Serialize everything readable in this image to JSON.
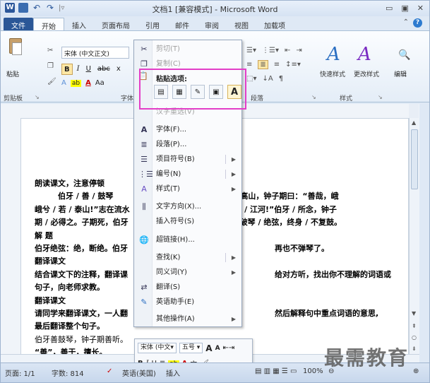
{
  "window": {
    "title": "文档1 [兼容模式] - Microsoft Word",
    "controls": [
      "▭",
      "▣",
      "✕"
    ]
  },
  "qat": {
    "separator": "|▿"
  },
  "tabs": [
    {
      "label": "文件"
    },
    {
      "label": "开始"
    },
    {
      "label": "插入"
    },
    {
      "label": "页面布局"
    },
    {
      "label": "引用"
    },
    {
      "label": "邮件"
    },
    {
      "label": "审阅"
    },
    {
      "label": "视图"
    },
    {
      "label": "加载项"
    }
  ],
  "ribbon": {
    "paste_label": "粘贴",
    "clipboard_group": "剪贴板",
    "font_group": "字体",
    "paragraph_group": "段落",
    "styles_group": "样式",
    "font_name": "宋体 (中文正文)",
    "quick_styles": "快速样式",
    "change_styles": "更改样式",
    "edit": "编辑",
    "bold": "B",
    "italic": "I",
    "underline": "U",
    "strike": "abc",
    "superscript": "x",
    "font_color": "A",
    "highlight": "ab",
    "font_preview": "Aa",
    "ribbon_collapse": "⌃"
  },
  "context_menu": {
    "cut": "剪切(T)",
    "copy": "复制(C)",
    "paste_options": "粘贴选项:",
    "paste_opt_text": "A",
    "text_reconvert": "汉字重选(V)",
    "font": "字体(F)...",
    "paragraph": "段落(P)...",
    "bullets": "项目符号(B)",
    "numbering": "编号(N)",
    "styles": "样式(T)",
    "text_direction": "文字方向(X)...",
    "insert_symbol": "插入符号(S)",
    "hyperlink": "超链接(H)...",
    "lookup": "查找(K)",
    "synonyms": "同义词(Y)",
    "translate": "翻译(S)",
    "english_assistant": "英语助手(E)",
    "other_actions": "其他操作(A)"
  },
  "mini_toolbar": {
    "font": "宋体 (中文▾",
    "size": "五号 ▾",
    "grow": "A",
    "shrink": "A",
    "bold": "B",
    "italic": "I",
    "underline": "U"
  },
  "document": {
    "lines": [
      {
        "text": "朗读课文，注意停顿",
        "bold": true
      },
      {
        "text": "　　　伯牙 / 善 / 鼓琴",
        "bold": true,
        "tail": "志在高山，钟子期曰：“善哉，峨"
      },
      {
        "text": "峨兮 / 若 / 泰山!”志在流水",
        "bold": true,
        "tail": "兮 / 若 / 江河!”伯牙 / 所念，钟子"
      },
      {
        "text": "期 / 必得之。子期死，伯牙",
        "bold": true,
        "tail": "破琴 / 绝弦，终身 / 不复鼓。"
      },
      {
        "text": "解 题",
        "bold": true
      },
      {
        "text": "伯牙绝弦：绝，断绝。伯牙",
        "bold": true,
        "tail": "再也不弹琴了。"
      },
      {
        "text": "翻译课文",
        "bold": true
      },
      {
        "text": "结合课文下的注释，翻译课",
        "bold": true,
        "tail": "给对方听，找出你不理解的词语或"
      },
      {
        "text": "句子，向老师求教。",
        "bold": true
      },
      {
        "text": "翻译课文",
        "bold": true
      },
      {
        "text": "请同学来翻译课文，一人翻",
        "bold": true,
        "tail": "然后解释句中重点词语的意思,"
      },
      {
        "text": "最后翻译整个句子。",
        "bold": true
      },
      {
        "text": "伯牙善鼓琴，钟子期善听。",
        "bold": false
      },
      {
        "text": "“善”，善于，擅长。",
        "bold": true
      }
    ]
  },
  "status": {
    "page": "页面: 1/1",
    "words": "字数: 814",
    "lang": "英语(美国)",
    "insert": "插入",
    "zoom": "100%"
  },
  "watermark": "最需教育"
}
